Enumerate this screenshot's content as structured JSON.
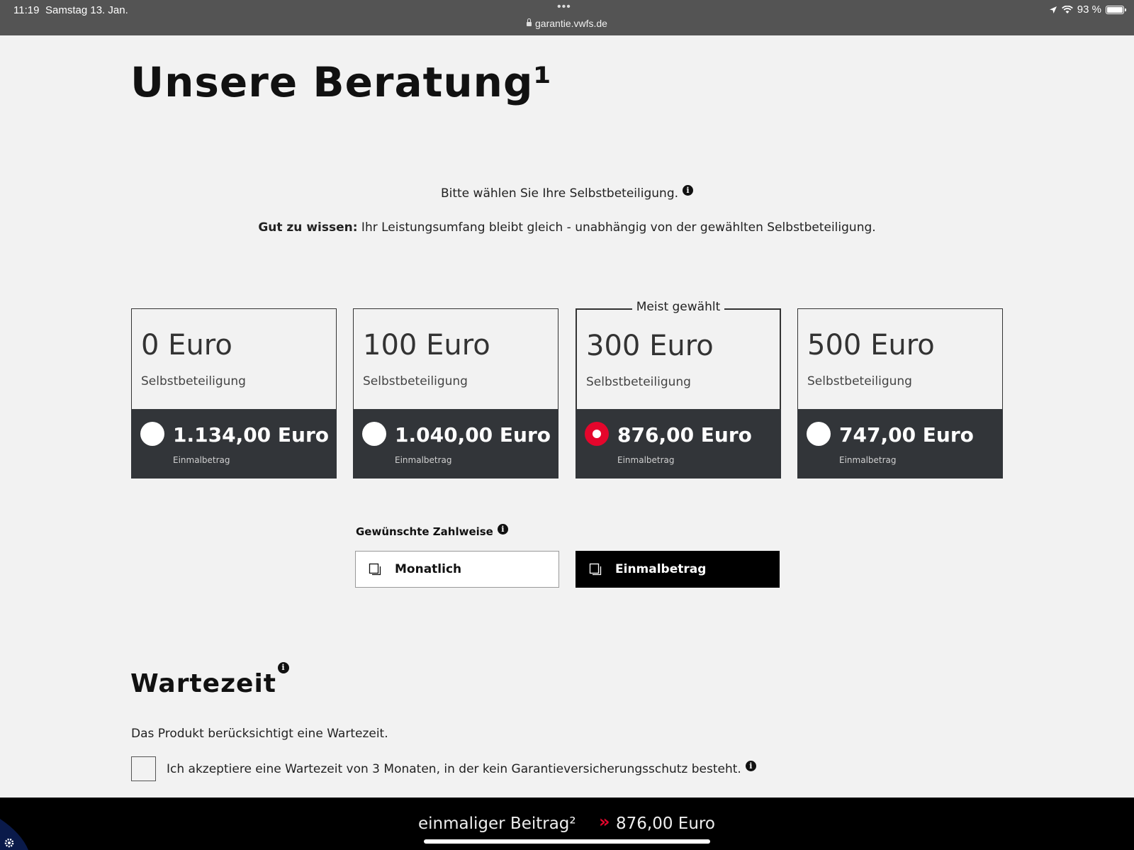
{
  "statusbar": {
    "time": "11:19",
    "date": "Samstag 13. Jan.",
    "url": "garantie.vwfs.de",
    "battery": "93 %",
    "battery_level": 0.93
  },
  "title": "Unsere Beratung¹",
  "intro": {
    "prompt": "Bitte wählen Sie Ihre Selbstbeteiligung.",
    "note_bold": "Gut zu wissen:",
    "note_text": " Ihr Leistungsumfang bleibt gleich - unabhängig von der gewählten Selbstbeteiligung."
  },
  "options": [
    {
      "amount": "0 Euro",
      "label": "Selbstbeteiligung",
      "price": "1.134,00 Euro",
      "price_label": "Einmalbetrag",
      "selected": false
    },
    {
      "amount": "100 Euro",
      "label": "Selbstbeteiligung",
      "price": "1.040,00 Euro",
      "price_label": "Einmalbetrag",
      "selected": false
    },
    {
      "amount": "300 Euro",
      "label": "Selbstbeteiligung",
      "price": "876,00 Euro",
      "price_label": "Einmalbetrag",
      "selected": true,
      "badge": "Meist gewählt"
    },
    {
      "amount": "500 Euro",
      "label": "Selbstbeteiligung",
      "price": "747,00 Euro",
      "price_label": "Einmalbetrag",
      "selected": false
    }
  ],
  "payment": {
    "label": "Gewünschte Zahlweise",
    "monthly": "Monatlich",
    "single": "Einmalbetrag",
    "selected": "Einmalbetrag"
  },
  "waiting": {
    "heading": "Wartezeit",
    "text": "Das Produkt berücksichtigt eine Wartezeit.",
    "checkbox_label": "Ich akzeptiere eine Wartezeit von 3 Monaten, in der kein Garantieversicherungsschutz besteht.",
    "checked": false
  },
  "footer": {
    "label": "einmaliger Beitrag²",
    "arrow": "»",
    "value": "876,00 Euro"
  },
  "colors": {
    "accent": "#e4062c",
    "dark_panel": "#323539",
    "background": "#f2f2f2"
  }
}
